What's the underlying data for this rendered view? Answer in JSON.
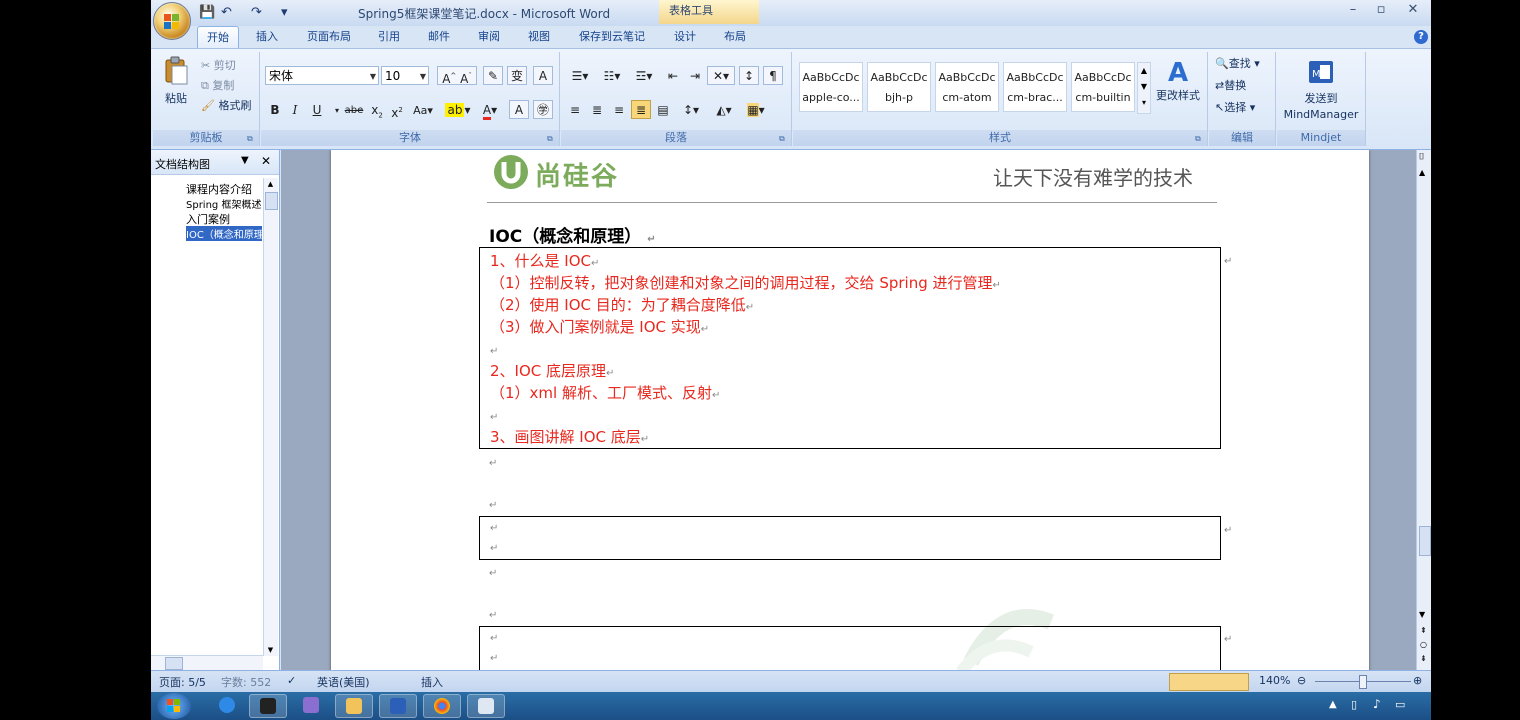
{
  "window": {
    "title": "Spring5框架课堂笔记.docx - Microsoft Word",
    "contextual_tab_title": "表格工具",
    "controls": {
      "minimize": "–",
      "restore": "▫",
      "close": "✕"
    }
  },
  "quick_access": {
    "save": "💾",
    "undo": "↶",
    "redo": "↷",
    "customize": "▾"
  },
  "tabs": [
    "开始",
    "插入",
    "页面布局",
    "引用",
    "邮件",
    "审阅",
    "视图",
    "保存到云笔记",
    "设计",
    "布局"
  ],
  "ribbon": {
    "clipboard": {
      "label": "剪贴板",
      "paste": "粘贴",
      "cut": "剪切",
      "copy": "复制",
      "format_painter": "格式刷"
    },
    "font": {
      "label": "字体",
      "font_name": "宋体",
      "font_size": "10"
    },
    "paragraph": {
      "label": "段落"
    },
    "styles": {
      "label": "样式",
      "items": [
        {
          "sample": "AaBbCcDc",
          "name": "apple-co..."
        },
        {
          "sample": "AaBbCcDc",
          "name": "bjh-p"
        },
        {
          "sample": "AaBbCcDc",
          "name": "cm-atom"
        },
        {
          "sample": "AaBbCcDc",
          "name": "cm-brac..."
        },
        {
          "sample": "AaBbCcDc",
          "name": "cm-builtin"
        }
      ],
      "change_styles": "更改样式"
    },
    "editing": {
      "label": "编辑",
      "find": "查找",
      "replace": "替换",
      "select": "选择"
    },
    "mindjet": {
      "label": "Mindjet",
      "send_line1": "发送到",
      "send_line2": "MindManager"
    }
  },
  "docmap": {
    "title": "文档结构图",
    "items": [
      "课程内容介绍",
      "Spring 框架概述",
      "入门案例",
      "IOC（概念和原理）"
    ]
  },
  "document": {
    "header_logo_text": "尚硅谷",
    "header_slogan": "让天下没有难学的技术",
    "heading": "IOC（概念和原理）",
    "box_lines": [
      "1、什么是 IOC",
      "（1）控制反转，把对象创建和对象之间的调用过程，交给 Spring 进行管理",
      "（2）使用 IOC 目的：为了耦合度降低",
      "（3）做入门案例就是 IOC 实现",
      "",
      "2、IOC 底层原理",
      "（1）xml 解析、工厂模式、反射",
      "",
      "3、画图讲解 IOC 底层"
    ],
    "para_mark": "↵"
  },
  "statusbar": {
    "page": "页面: 5/5",
    "words": "字数: 552",
    "language": "英语(美国)",
    "insert_mode": "插入",
    "zoom": "140%"
  },
  "colors": {
    "red_text": "#e8281e",
    "ribbon_blue": "#15428b"
  }
}
